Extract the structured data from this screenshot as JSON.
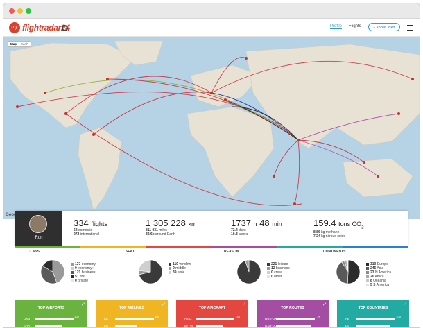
{
  "app": {
    "logo_mark": "my",
    "brand": "flightradar24"
  },
  "nav": {
    "profile": "Profile",
    "flights": "Flights",
    "add_flight": "+ ADD FLIGHT"
  },
  "map": {
    "tabs": [
      "Map",
      "Earth"
    ],
    "attribution": "Google"
  },
  "user": {
    "name": "Ron"
  },
  "stats": {
    "flights": {
      "value": "334",
      "unit": "flights",
      "lines": [
        {
          "num": "62",
          "text": "domestic"
        },
        {
          "num": "272",
          "text": "international"
        }
      ]
    },
    "distance": {
      "value": "1 305 228",
      "unit": "km",
      "lines": [
        {
          "num": "811 031",
          "text": "miles"
        },
        {
          "num": "32.6x",
          "text": "around Earth"
        }
      ]
    },
    "time": {
      "hours": "1737",
      "h": "h",
      "minutes": "48",
      "min": "min",
      "lines": [
        {
          "num": "72.4",
          "text": "days"
        },
        {
          "num": "10.3",
          "text": "weeks"
        }
      ]
    },
    "co2": {
      "value": "159.4",
      "unit": "tons CO",
      "sub2": "2",
      "lines": [
        {
          "num": "8.86",
          "text": "kg methane"
        },
        {
          "num": "7.24",
          "text": "kg nitrous oxide"
        }
      ]
    }
  },
  "breakdowns": [
    {
      "title": "CLASS",
      "items": [
        {
          "num": "137",
          "label": "economy",
          "color": "#9a9a9a"
        },
        {
          "num": "0",
          "label": "economy+",
          "color": "#cfcfcf"
        },
        {
          "num": "121",
          "label": "business",
          "color": "#5a5a5a"
        },
        {
          "num": "51",
          "label": "first",
          "color": "#2c2c2c"
        },
        {
          "num": "0",
          "label": "private",
          "color": "#e6e6e6"
        }
      ],
      "values": [
        137,
        0,
        121,
        51,
        0
      ]
    },
    {
      "title": "SEAT",
      "items": [
        {
          "num": "119",
          "label": "window",
          "color": "#3a3a3a"
        },
        {
          "num": "9",
          "label": "middle",
          "color": "#9a9a9a"
        },
        {
          "num": "39",
          "label": "aisle",
          "color": "#cfcfcf"
        }
      ],
      "values": [
        119,
        9,
        39
      ]
    },
    {
      "title": "REASON",
      "items": [
        {
          "num": "221",
          "label": "leisure",
          "color": "#3a3a3a"
        },
        {
          "num": "12",
          "label": "business",
          "color": "#9a9a9a"
        },
        {
          "num": "0",
          "label": "crew",
          "color": "#cfcfcf"
        },
        {
          "num": "0",
          "label": "other",
          "color": "#e6e6e6"
        }
      ],
      "values": [
        221,
        12,
        0,
        0
      ]
    },
    {
      "title": "CONTINENTS",
      "items": [
        {
          "num": "310",
          "label": "Europe",
          "color": "#2c2c2c"
        },
        {
          "num": "245",
          "label": "Asia",
          "color": "#5a5a5a"
        },
        {
          "num": "23",
          "label": "N America",
          "color": "#8a8a8a"
        },
        {
          "num": "20",
          "label": "Africa",
          "color": "#a9a9a9"
        },
        {
          "num": "8",
          "label": "Oceania",
          "color": "#c6c6c6"
        },
        {
          "num": "5",
          "label": "S America",
          "color": "#e2e2e2"
        }
      ],
      "values": [
        310,
        245,
        23,
        20,
        8,
        5
      ]
    }
  ],
  "tiles": [
    {
      "title": "TOP AIRPORTS",
      "color": "#69b33e",
      "rows": [
        {
          "label": "DXB",
          "num": "100",
          "fill": 1.0
        },
        {
          "label": "ERA",
          "num": "",
          "fill": 0.7
        }
      ]
    },
    {
      "title": "TOP AIRLINES",
      "color": "#f0b522",
      "rows": [
        {
          "label": "EK",
          "num": "100",
          "fill": 1.0
        },
        {
          "label": "LH",
          "num": "",
          "fill": 0.55
        }
      ]
    },
    {
      "title": "TOP AIRCRAFT",
      "color": "#e3473f",
      "rows": [
        {
          "label": "A332",
          "num": "44",
          "fill": 1.0
        },
        {
          "label": "B77W",
          "num": "",
          "fill": 0.7
        }
      ]
    },
    {
      "title": "TOP ROUTES",
      "color": "#a34ea3",
      "rows": [
        {
          "label": "DUS-DXB",
          "num": "29",
          "fill": 1.0
        },
        {
          "label": "DXB-DUS",
          "num": "",
          "fill": 0.9
        }
      ]
    },
    {
      "title": "TOP COUNTRIES",
      "color": "#22aaa3",
      "rows": [
        {
          "label": "AE",
          "num": "100",
          "fill": 1.0
        },
        {
          "label": "DE",
          "num": "",
          "fill": 0.85
        }
      ]
    }
  ],
  "rainbow_colors": [
    "#69b33e",
    "#f0b522",
    "#e3473f",
    "#a34ea3",
    "#22aaa3",
    "#2a7fd8"
  ]
}
